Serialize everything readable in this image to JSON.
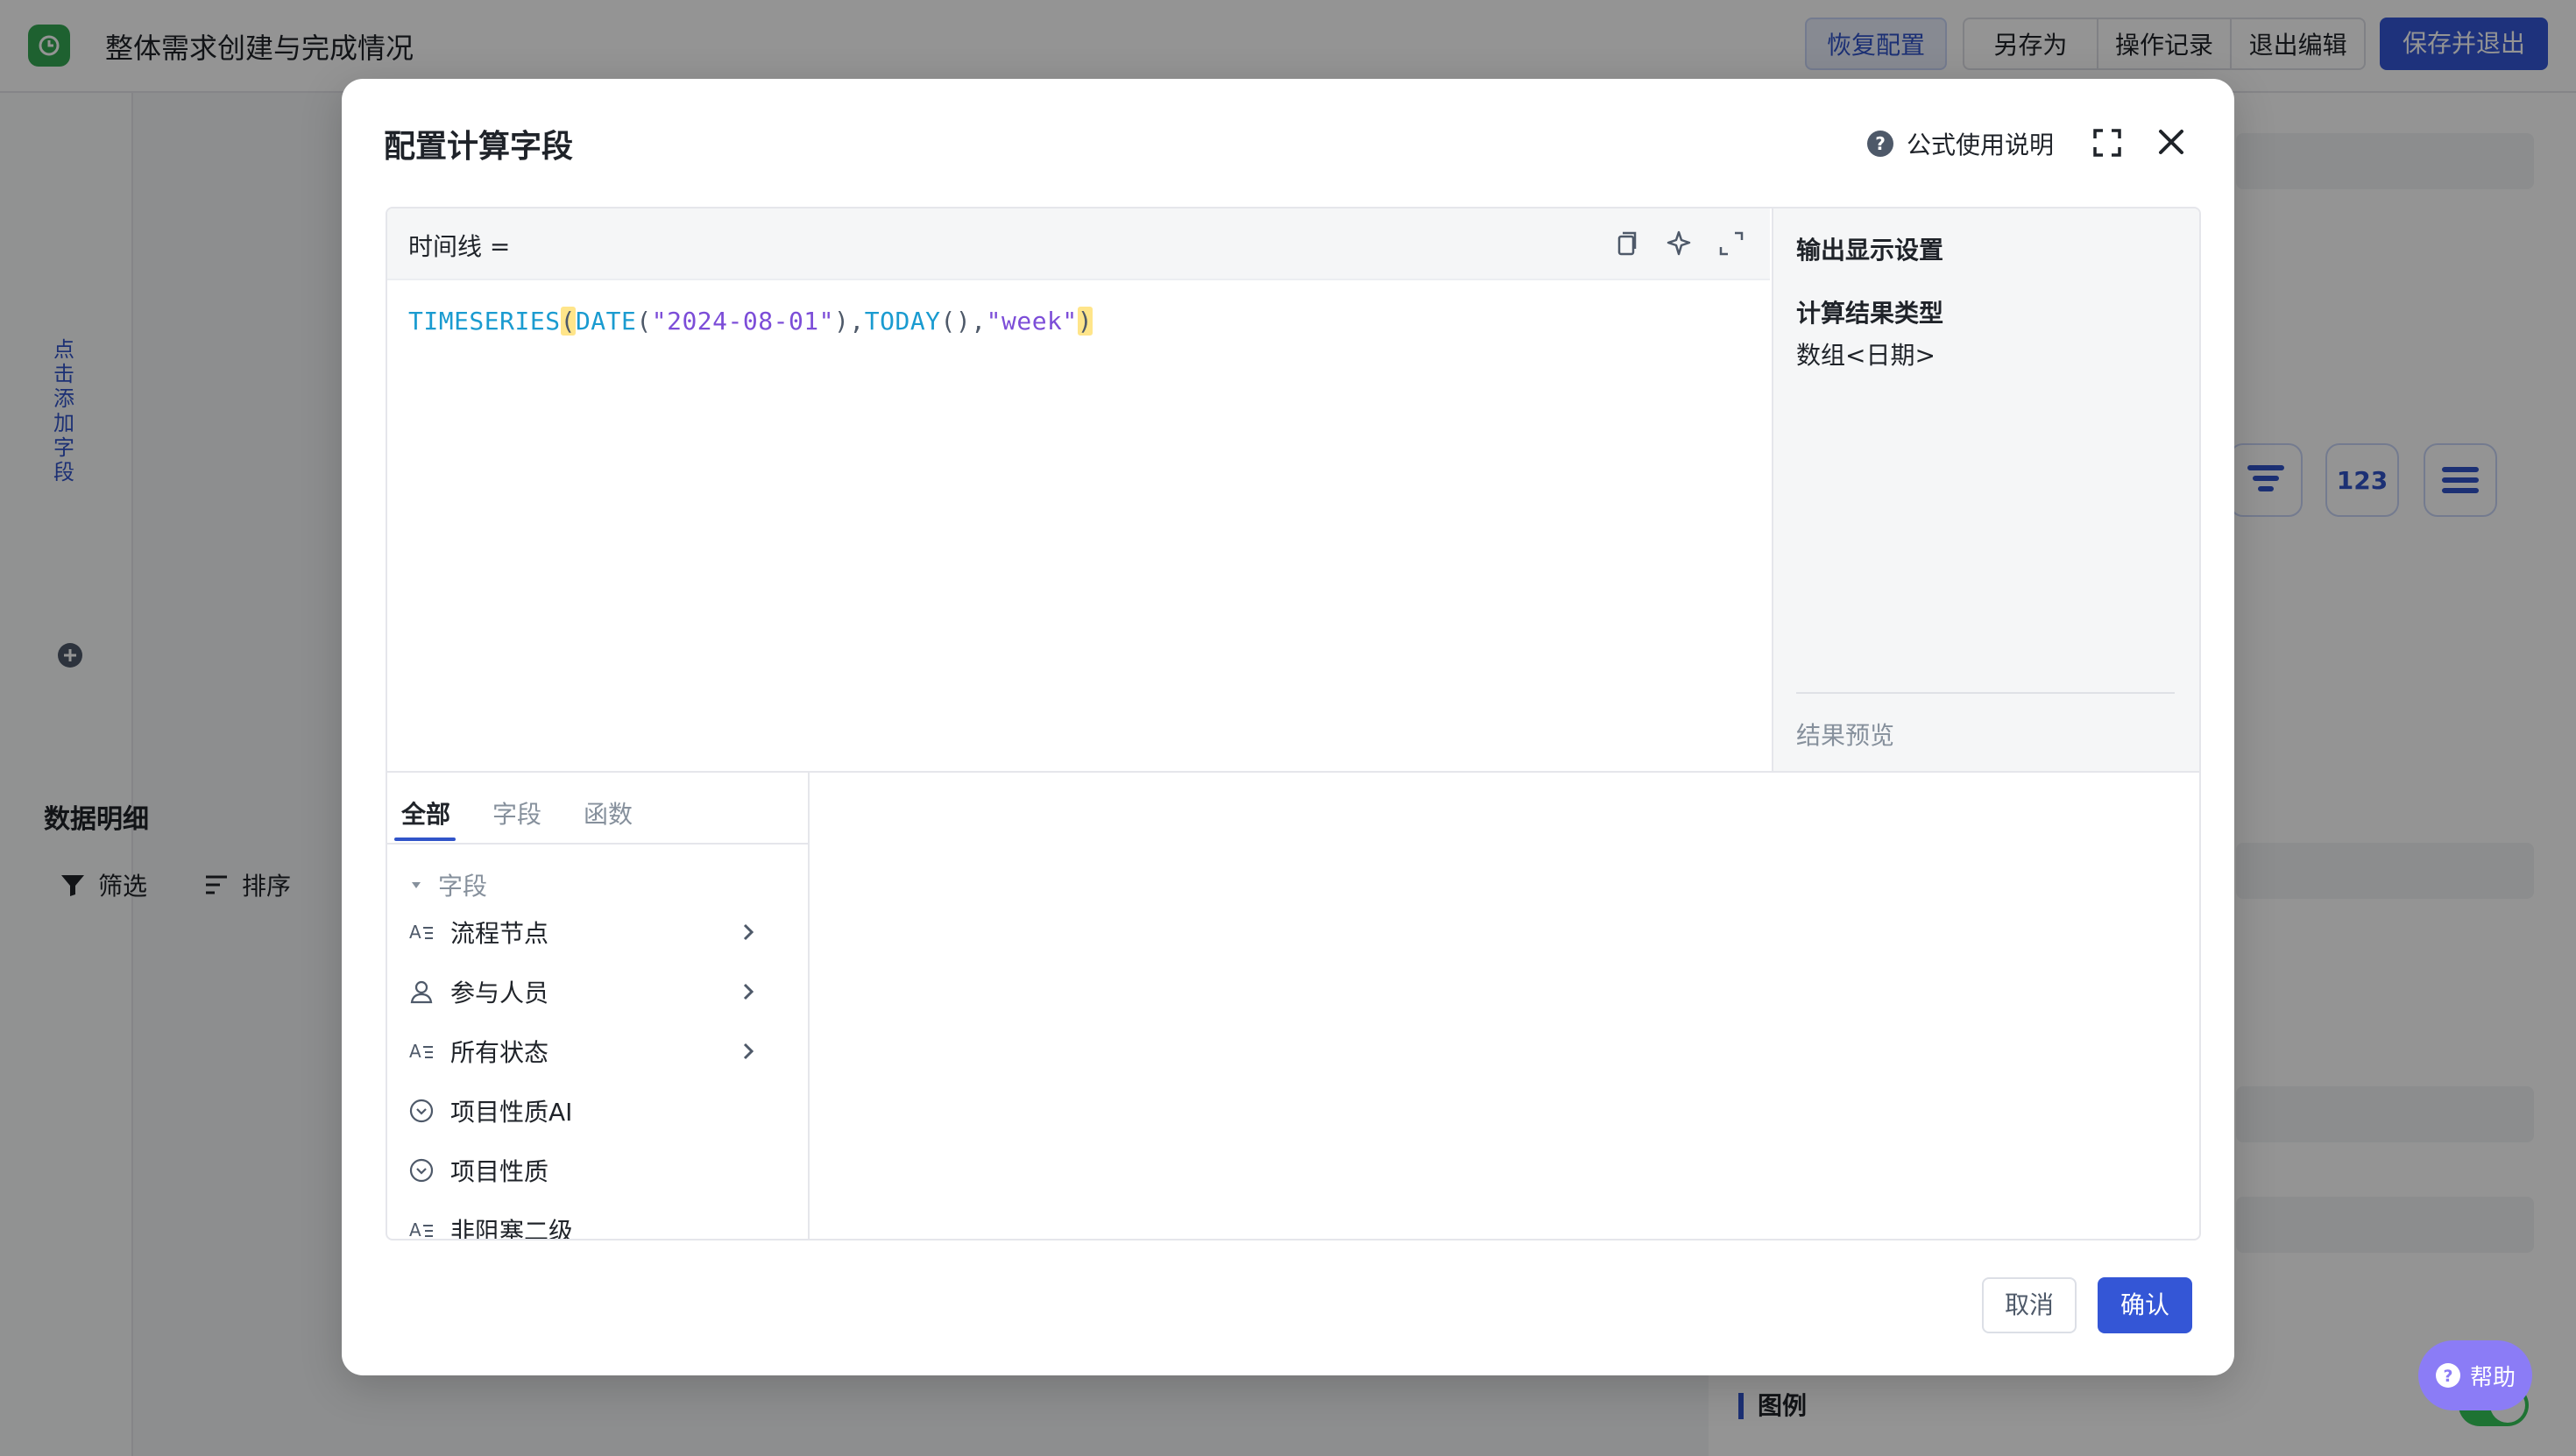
{
  "app": {
    "title": "整体需求创建与完成情况",
    "toolbar": {
      "restore": "恢复配置",
      "save_as": "另存为",
      "history": "操作记录",
      "exit_edit": "退出编辑",
      "save_exit": "保存并退出"
    },
    "left": {
      "add_field_link": "点击添加字段",
      "section_title": "数据明细",
      "filter": "筛选",
      "sort": "排序"
    },
    "right": {
      "numeric_icon_label": "123",
      "legend_label": "图例"
    },
    "help_fab": "帮助"
  },
  "modal": {
    "title": "配置计算字段",
    "help_link": "公式使用说明",
    "editor": {
      "field_label": "时间线 =",
      "formula": {
        "fn1": "TIMESERIES",
        "open1": "(",
        "fn2": "DATE",
        "open2": "(",
        "str1": "\"2024-08-01\"",
        "close2": ")",
        "comma1": ",",
        "fn3": "TODAY",
        "parens3": "()",
        "comma2": ",",
        "str2": "\"week\"",
        "close1": ")"
      }
    },
    "output": {
      "title": "输出显示设置",
      "result_type_label": "计算结果类型",
      "result_type_value": "数组<日期>",
      "preview_label": "结果预览"
    },
    "library": {
      "tabs": [
        "全部",
        "字段",
        "函数"
      ],
      "group_label": "字段",
      "items": [
        {
          "label": "流程节点",
          "icon": "text-field-icon",
          "has_children": true
        },
        {
          "label": "参与人员",
          "icon": "person-icon",
          "has_children": true
        },
        {
          "label": "所有状态",
          "icon": "text-field-icon",
          "has_children": true
        },
        {
          "label": "项目性质AI",
          "icon": "single-select-icon",
          "has_children": false
        },
        {
          "label": "项目性质",
          "icon": "single-select-icon",
          "has_children": false
        },
        {
          "label": "非阻塞二级",
          "icon": "text-field-icon",
          "has_children": false
        }
      ]
    },
    "cancel": "取消",
    "confirm": "确认"
  },
  "colors": {
    "primary": "#3456d6",
    "function": "#1a9bd0",
    "string": "#7c4dd8",
    "highlight": "#ffe58a"
  }
}
